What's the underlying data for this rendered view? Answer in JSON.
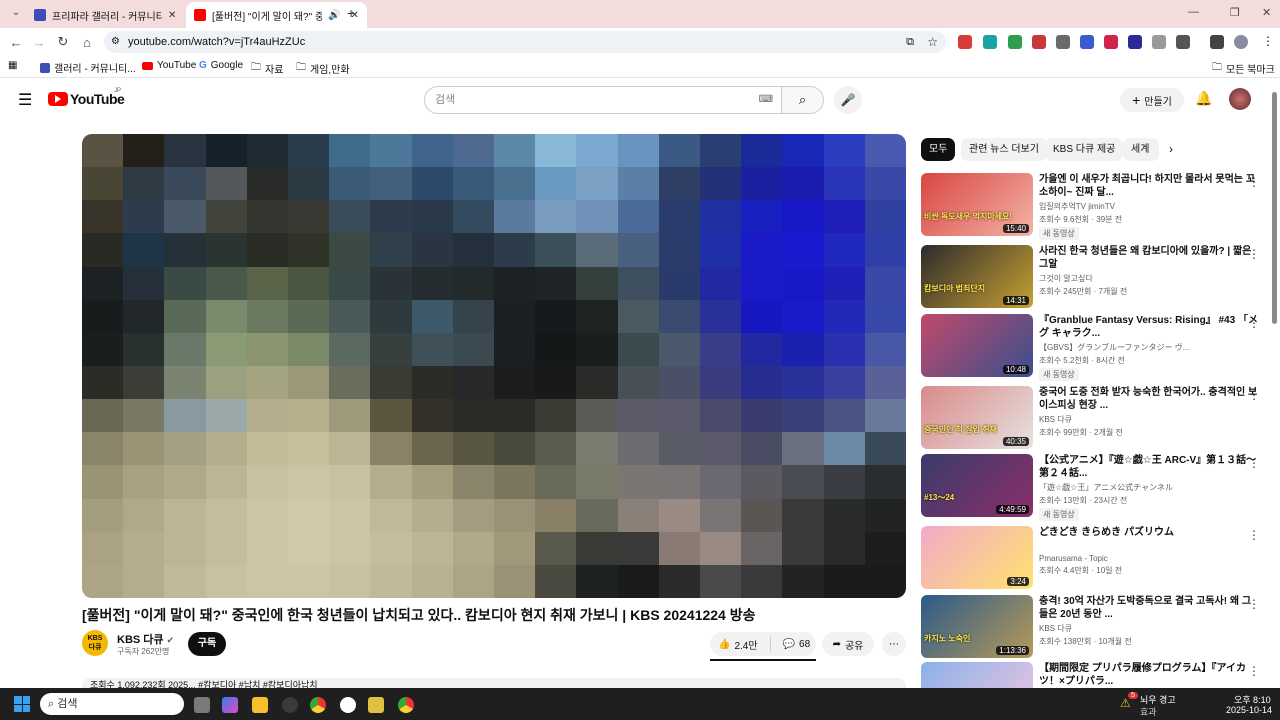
{
  "browser": {
    "tabs": [
      {
        "label": "프리파라 갤러리 - 커뮤니티 포",
        "color": "#3b4fb8"
      },
      {
        "label": "[풀버전] \"이게 말이 돼?\" 중",
        "color": "#ff0000"
      }
    ],
    "new_tab": "+",
    "url": "youtube.com/watch?v=jTr4auHzZUc",
    "bookmarks": [
      "갤러리 - 커뮤니티...",
      "YouTube",
      "Google",
      "자료",
      "게임,만화"
    ],
    "bookmarks_right": "모든 북마크"
  },
  "youtube": {
    "logo_text": "YouTube",
    "region": "JP",
    "search_placeholder": "검색",
    "create_label": "만들기",
    "video": {
      "title": "[풀버전] \"이게 말이 돼?\" 중국인에 한국 청년들이 납치되고 있다.. 캄보디아 현지 취재 가보니 | KBS 20241224 방송",
      "channel": "KBS 다큐",
      "channel_logo": "KBS\n다큐",
      "subscribers": "구독자 262만명",
      "subscribe": "구독",
      "likes": "2.4만",
      "comments": "68",
      "share": "공유",
      "description_preview": "조회수 1,092,232회 2025... #캄보디아 #납치 #캄보디아납치"
    },
    "chips": [
      "모두",
      "관련 뉴스 더보기",
      "KBS 다큐 제공",
      "세계"
    ],
    "recommendations": [
      {
        "title": "가을엔 이 새우가 최곱니다! 하지만 몰라서 못먹는 꼬소하이~ 진짜 달...",
        "channel": "입질의추억TV jiminTV",
        "meta": "조회수 9.6천회 · 39분 전",
        "badge": "새 동영상",
        "duration": "15:40",
        "thumb_text": "비싼 독도새우 먹지마세요!",
        "c1": "#d9463f",
        "c2": "#f3b3a8"
      },
      {
        "title": "사라진 한국 청년들은 왜 캄보디아에 있을까? | 짧은 그알",
        "channel": "그것이 알고싶다",
        "meta": "조회수 245만회 · 7개월 전",
        "badge": "",
        "duration": "14:31",
        "thumb_text": "캄보디아 범죄단지",
        "c1": "#2b2b2b",
        "c2": "#c8a033"
      },
      {
        "title": "『Granblue Fantasy Versus: Rising』 #43 「メグ キャラク...",
        "channel": "【GBVS】グランブルーファンタジー ヴ...",
        "meta": "조회수 5.2천회 · 8시간 전",
        "badge": "새 동영상",
        "duration": "10:48",
        "thumb_text": "",
        "c1": "#c04a6a",
        "c2": "#3a4f8f"
      },
      {
        "title": "중국어 도중 전화 받자 능숙한 한국어가.. 충격적인 보이스피싱 현장 ...",
        "channel": "KBS 다큐",
        "meta": "조회수 99만회 · 2개월 전",
        "badge": "",
        "duration": "40:35",
        "thumb_text": "중국인인 척 잠입 취재",
        "c1": "#d98a8a",
        "c2": "#e7e2df"
      },
      {
        "title": "【公式アニメ】『遊☆戯☆王 ARC-V』第１３話〜第２４話...",
        "channel": "「遊☆戯☆王」アニメ公式チャンネル",
        "meta": "조회수 13만회 · 23시간 전",
        "badge": "새 동영상",
        "duration": "4:49:59",
        "thumb_text": "#13〜24",
        "c1": "#3b3b6b",
        "c2": "#8a2f6a"
      },
      {
        "title": "どきどき きらめき パズリウム",
        "channel": "Pmarusama - Topic",
        "meta": "조회수 4.4만회 · 10일 전",
        "badge": "",
        "duration": "3:24",
        "thumb_text": "",
        "c1": "#f2a9c9",
        "c2": "#ffe36e"
      },
      {
        "title": "충격! 30억 자산가 도박중독으로 결국 고독사! 왜 그들은 20년 동안 ...",
        "channel": "KBS 다큐",
        "meta": "조회수 138만회 · 10개월 전",
        "badge": "",
        "duration": "1:13:36",
        "thumb_text": "카지노 노숙인",
        "c1": "#2a5a8a",
        "c2": "#b89a5a"
      },
      {
        "title": "【期間限定 プリパラ履修プログラム】『アイカツ！×プリパラ...",
        "channel": "",
        "meta": "",
        "badge": "",
        "duration": "",
        "thumb_text": "",
        "c1": "#8ab0e8",
        "c2": "#f2c6e0"
      }
    ]
  },
  "taskbar": {
    "search_placeholder": "검색",
    "weather_title": "뇌우 경고",
    "weather_sub": "효과",
    "weather_badge": "5",
    "time": "오후 8:10",
    "date": "2025-10-14"
  },
  "video_palette": [
    "#5a5243",
    "#23201a",
    "#2a3440",
    "#16222a",
    "#1f2a32",
    "#283c4c",
    "#3e6c8a",
    "#4c789a",
    "#40658c",
    "#4e6a90",
    "#5c88aa",
    "#8ab8d8",
    "#7aa8d0",
    "#6a94c0",
    "#3a5a84",
    "#2a3e74",
    "#1a2a98",
    "#1a28b8",
    "#2a3cc0",
    "#4a5ab0",
    "#4a4636",
    "#2e3a44",
    "#3a4a5a",
    "#55585a",
    "#2a2c2a",
    "#2c3a44",
    "#3a5a76",
    "#42607c",
    "#2e4a6a",
    "#3a5a7a",
    "#4a7090",
    "#6a9ac0",
    "#7aa0c4",
    "#5a80a8",
    "#2e3e64",
    "#243078",
    "#1a20a0",
    "#1a1cb0",
    "#2a34b8",
    "#3a48a8",
    "#38342a",
    "#2c3c4c",
    "#4a5a6a",
    "#40443a",
    "#363630",
    "#3a3a34",
    "#3a4c5a",
    "#2c3c4c",
    "#2a3a4a",
    "#344a5e",
    "#5a7aa0",
    "#7a9cc0",
    "#7090b8",
    "#4a6a98",
    "#2a3c6c",
    "#2030a0",
    "#1820c0",
    "#1818c8",
    "#2020b8",
    "#3040a0",
    "#2a2a24",
    "#203448",
    "#263038",
    "#2a3430",
    "#2a2c26",
    "#303428",
    "#3c4a44",
    "#30404a",
    "#2a3442",
    "#24303c",
    "#2c3c4a",
    "#3c505a",
    "#5a6c7a",
    "#4a6080",
    "#2a3c6a",
    "#2030a8",
    "#1a1ac8",
    "#1a1ad0",
    "#2028c0",
    "#3040a8",
    "#1c2224",
    "#26303a",
    "#3a4a44",
    "#4a5a4a",
    "#5a6448",
    "#4a5640",
    "#3a4a48",
    "#2a3438",
    "#242c30",
    "#222a2c",
    "#1c2224",
    "#1e2426",
    "#34403e",
    "#3e5060",
    "#2a3a6a",
    "#2228a0",
    "#1a1ac8",
    "#1818c8",
    "#2020b8",
    "#3a48a8",
    "#181c1c",
    "#22282a",
    "#5a6a58",
    "#7a8a6c",
    "#6a7a60",
    "#5a6a54",
    "#4a5a58",
    "#2e3a3e",
    "#3e5a6a",
    "#34444a",
    "#1c2022",
    "#161a1c",
    "#1e2424",
    "#4a5a60",
    "#3a4a70",
    "#2a309a",
    "#1818c0",
    "#1a1ac8",
    "#2228b8",
    "#3848a8",
    "#1a1e1c",
    "#283030",
    "#6a7a6a",
    "#8a9a74",
    "#8a9470",
    "#7a8a68",
    "#5a6a60",
    "#36403e",
    "#405058",
    "#3a4a50",
    "#1a2022",
    "#141818",
    "#1a1e1e",
    "#3a4a4e",
    "#4a5a6c",
    "#3a3e8a",
    "#2228a0",
    "#1a20b0",
    "#2a30b0",
    "#4a58a8",
    "#2a2c26",
    "#3a3e36",
    "#7a8470",
    "#9aa080",
    "#a4a480",
    "#9a9878",
    "#6a6c5c",
    "#3a3c34",
    "#2a2c28",
    "#26282a",
    "#1c1e1e",
    "#181a1a",
    "#2a2c2a",
    "#4a5058",
    "#4a5068",
    "#3a3c80",
    "#282e90",
    "#2a309a",
    "#3a40a0",
    "#5a6098"
  ],
  "video_palette_bottom": [
    "#6a6854",
    "#7a7a64",
    "#8a98a0",
    "#9aa8a8",
    "#b4ae8c",
    "#b8b08c",
    "#a09a7c",
    "#5a5640",
    "#34302a",
    "#2a2a26",
    "#2a2a26",
    "#3a3c34",
    "#5a5c58",
    "#5a5a68",
    "#5a5a6a",
    "#4a4a6a",
    "#3a3c70",
    "#3a4078",
    "#4a5484",
    "#6a7a9a",
    "#8a8468",
    "#9a9474",
    "#a4a084",
    "#b4ae8c",
    "#c4bc98",
    "#c8c09c",
    "#bcb494",
    "#8a8266",
    "#6a6650",
    "#5a5644",
    "#4a4a3c",
    "#5a5c50",
    "#7a7c70",
    "#6a6c70",
    "#5a5c68",
    "#5a5a6c",
    "#4a4c64",
    "#6a7280",
    "#6a8aa8",
    "#3a4a5a",
    "#9a9474",
    "#a8a080",
    "#b0a888",
    "#bcb494",
    "#c8c0a0",
    "#ccc4a4",
    "#c8c0a0",
    "#b4ac8c",
    "#a49c7c",
    "#8a846a",
    "#7a7660",
    "#6a6a58",
    "#7a7a6a",
    "#7a7674",
    "#7a7474",
    "#6a6870",
    "#5a5a60",
    "#4a4c54",
    "#3a3e44",
    "#2a2e30",
    "#a49e7c",
    "#b0a888",
    "#bcb494",
    "#c4bc9c",
    "#ccc4a4",
    "#d0c8a8",
    "#ccc4a4",
    "#c0b898",
    "#b4ac8c",
    "#a49c80",
    "#9a9276",
    "#8a8068",
    "#6a6a5c",
    "#8a8078",
    "#9a8a84",
    "#7a7474",
    "#5a5654",
    "#3a3a3a",
    "#2a2c2c",
    "#222424",
    "#aaa282",
    "#b4ac8c",
    "#bcb494",
    "#c4bc9c",
    "#ccc4a4",
    "#d0c8a8",
    "#ccc4a4",
    "#c4bc9c",
    "#bcb494",
    "#b0a888",
    "#a09878",
    "#5a5a4c",
    "#3a3a36",
    "#3a3a38",
    "#8a7a74",
    "#9a8a84",
    "#6a6464",
    "#3a3a3c",
    "#2a2a2c",
    "#1c1e1e",
    "#aca484",
    "#b4ac8c",
    "#c0b898",
    "#c8c0a0",
    "#ccc4a4",
    "#ccc4a4",
    "#c8c0a0",
    "#c0b898",
    "#b8b090",
    "#aca484",
    "#9a9276",
    "#4a4a40",
    "#1e2220",
    "#1a1c1c",
    "#2a2c2c",
    "#4a4a4c",
    "#3a3a3c",
    "#222424",
    "#1a1c1c",
    "#1a1c1c",
    "#a89e80",
    "#b0a888",
    "#b8b090",
    "#bcb494",
    "#c4bc9c",
    "#c8c0a0",
    "#c4bc9c",
    "#bcb494",
    "#b4ac8c",
    "#a8a080",
    "#8a846a",
    "#3a3a34",
    "#181a1a",
    "#141616",
    "#141616",
    "#161818",
    "#181a1a",
    "#161818",
    "#181a1a",
    "#1e2020"
  ]
}
